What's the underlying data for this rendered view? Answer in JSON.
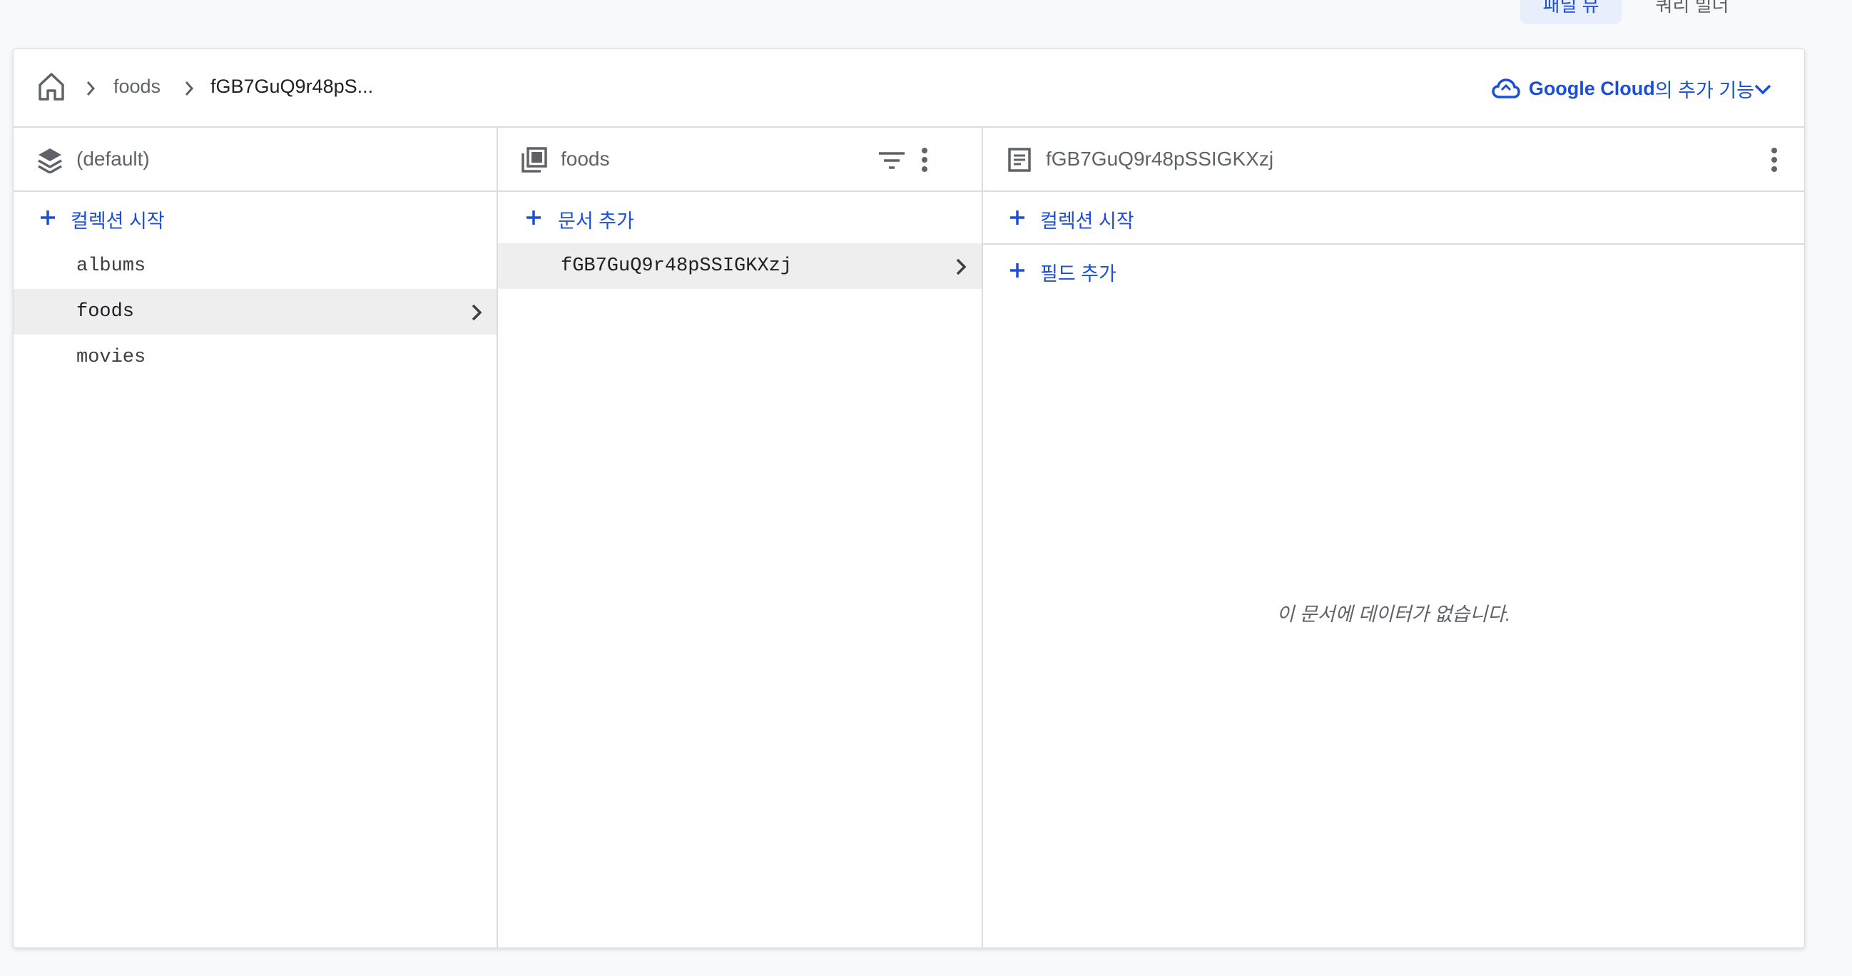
{
  "top_toolbar": {
    "panel_view_label": "패널 뷰",
    "query_builder_label": "쿼리 빌더"
  },
  "breadcrumb": {
    "items": [
      "foods",
      "fGB7GuQ9r48pS..."
    ]
  },
  "google_cloud": {
    "brand": "Google Cloud",
    "suffix": "의 추가 기능"
  },
  "columns": {
    "database": {
      "title": "(default)",
      "action_label": "컬렉션 시작",
      "items": [
        "albums",
        "foods",
        "movies"
      ],
      "selected_index": 1
    },
    "collection": {
      "title": "foods",
      "action_label": "문서 추가",
      "items": [
        "fGB7GuQ9r48pSSIGKXzj"
      ],
      "selected_index": 0
    },
    "document": {
      "title": "fGB7GuQ9r48pSSIGKXzj",
      "action_start_collection": "컬렉션 시작",
      "action_add_field": "필드 추가",
      "empty_message": "이 문서에 데이터가 없습니다."
    }
  },
  "colors": {
    "accent": "#1a4fd6",
    "selected_bg": "#eeeeee",
    "border": "#dadce0"
  },
  "icons": {
    "home": "home-icon",
    "database": "database-icon",
    "collection": "collection-icon",
    "document": "document-icon",
    "cloud": "cloud-icon"
  }
}
